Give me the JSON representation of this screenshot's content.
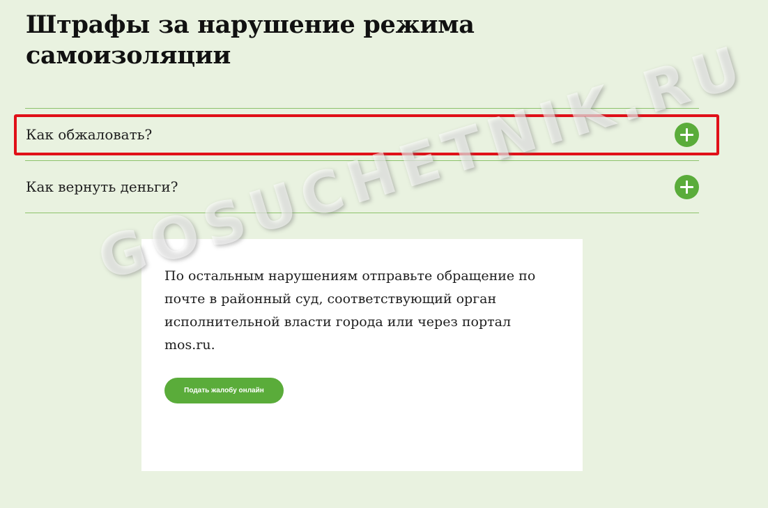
{
  "page": {
    "title": "Штрафы за нарушение режима самоизоляции"
  },
  "accordion": {
    "items": [
      {
        "label": "Как обжаловать?",
        "icon": "plus-circle-icon"
      },
      {
        "label": "Как вернуть деньги?",
        "icon": "plus-circle-icon"
      }
    ]
  },
  "info_card": {
    "text": "По остальным нарушениям отправьте обращение по почте в районный суд, соответствующий орган исполнительной власти города или через портал mos.ru.",
    "button_label": "Подать жалобу онлайн"
  },
  "watermark": {
    "text": "GOSUCHETNIK.RU"
  },
  "colors": {
    "background": "#e9f2e0",
    "accent_green": "#5aac3a",
    "divider": "#8cc26a",
    "highlight_red": "#e01018",
    "card": "#ffffff"
  }
}
